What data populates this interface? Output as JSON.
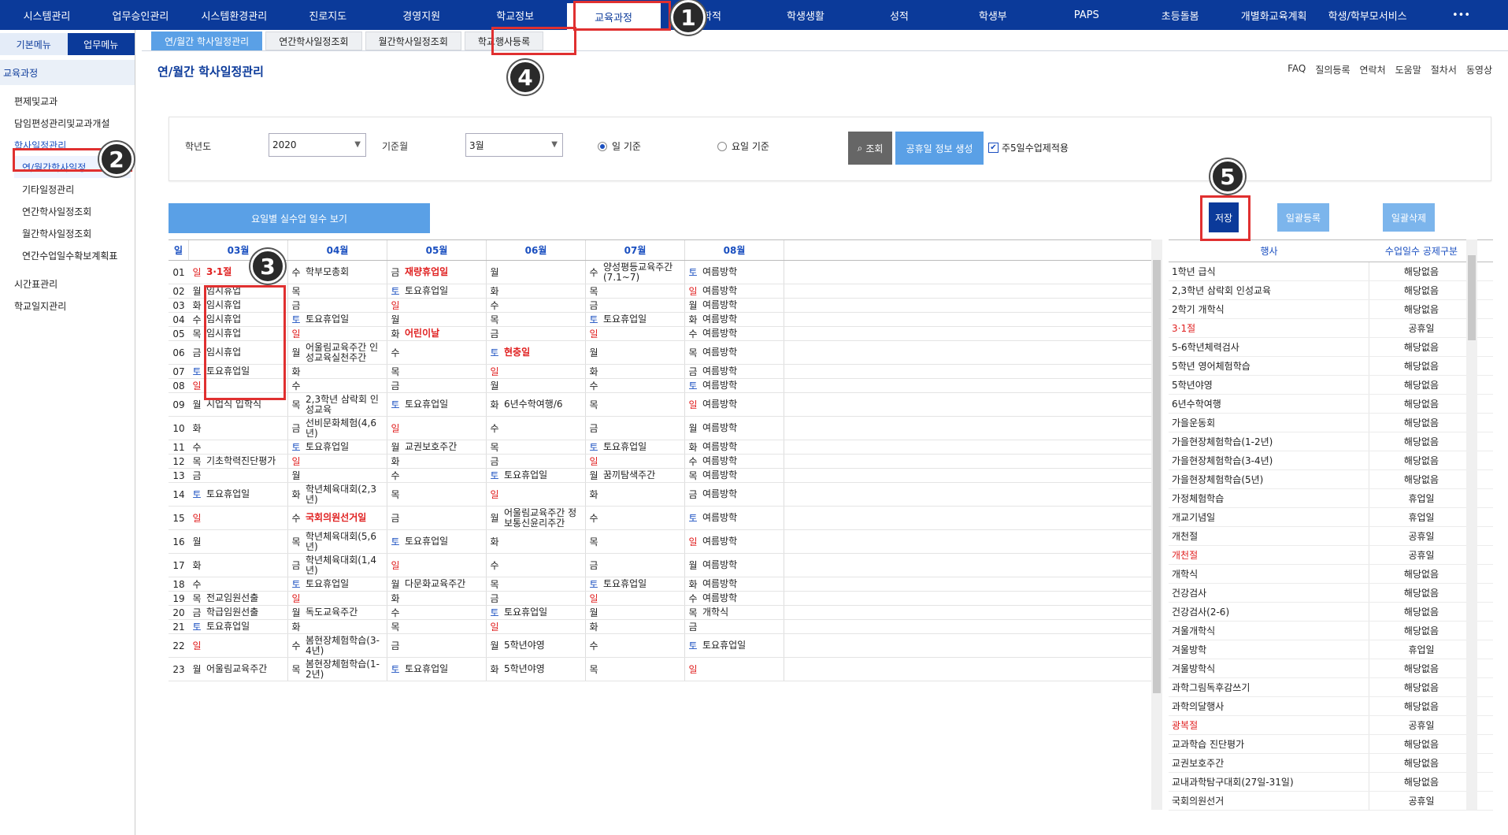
{
  "topnav": [
    "시스템관리",
    "업무승인관리",
    "시스템환경관리",
    "진로지도",
    "경영지원",
    "학교정보",
    "교육과정",
    "학적",
    "학생생활",
    "성적",
    "학생부",
    "PAPS",
    "초등돌봄",
    "개별화교육계획",
    "학생/학부모서비스",
    "•••"
  ],
  "sidebar": {
    "tabs": [
      "기본메뉴",
      "업무메뉴"
    ],
    "section": "교육과정",
    "items": [
      {
        "label": "편제및교과",
        "sub": false
      },
      {
        "label": "담임편성관리및교과개설",
        "sub": false
      },
      {
        "label": "학사일정관리",
        "sub": false,
        "hl": true
      },
      {
        "label": "연/월간학사일정",
        "sub": true,
        "active": true
      },
      {
        "label": "기타일정관리",
        "sub": true
      },
      {
        "label": "연간학사일정조회",
        "sub": true
      },
      {
        "label": "월간학사일정조회",
        "sub": true
      },
      {
        "label": "연간수업일수확보계획표",
        "sub": true
      },
      {
        "label": "",
        "gap": true
      },
      {
        "label": "시간표관리",
        "sub": false
      },
      {
        "label": "학교일지관리",
        "sub": false
      }
    ]
  },
  "subtabs": [
    "연/월간 학사일정관리",
    "연간학사일정조회",
    "월간학사일정조회",
    "학교행사등록"
  ],
  "page": {
    "title": "연/월간 학사일정관리",
    "links": [
      "FAQ",
      "질의등록",
      "연락처",
      "도움말",
      "절차서",
      "동영상"
    ]
  },
  "filter": {
    "year_label": "학년도",
    "year": "2020",
    "month_label": "기준월",
    "month": "3월",
    "radio1": "일 기준",
    "radio2": "요일 기준",
    "search": "조회",
    "generate": "공휴일 정보 생성",
    "chk_label": "주5일수업제적용",
    "chk_mark": "✔"
  },
  "view_btn": "요일별 실수업 일수 보기",
  "buttons": {
    "save": "저장",
    "bulk_reg": "일괄등록",
    "bulk_del": "일괄삭제"
  },
  "calendar": {
    "day_header": "일",
    "months": [
      "03월",
      "04월",
      "05월",
      "06월",
      "07월",
      "08월"
    ],
    "rows": [
      {
        "d": "01",
        "c": [
          [
            "일",
            "3·1절"
          ],
          [
            "수",
            "학부모총회"
          ],
          [
            "금",
            "재량휴업일"
          ],
          [
            "월",
            ""
          ],
          [
            "수",
            "양성평등교육주간(7.1~7)"
          ],
          [
            "토",
            "여름방학"
          ]
        ]
      },
      {
        "d": "02",
        "c": [
          [
            "월",
            "임시휴업"
          ],
          [
            "목",
            ""
          ],
          [
            "토",
            "토요휴업일"
          ],
          [
            "화",
            ""
          ],
          [
            "목",
            ""
          ],
          [
            "일",
            "여름방학"
          ]
        ]
      },
      {
        "d": "03",
        "c": [
          [
            "화",
            "임시휴업"
          ],
          [
            "금",
            ""
          ],
          [
            "일",
            ""
          ],
          [
            "수",
            ""
          ],
          [
            "금",
            ""
          ],
          [
            "월",
            "여름방학"
          ]
        ]
      },
      {
        "d": "04",
        "c": [
          [
            "수",
            "임시휴업"
          ],
          [
            "토",
            "토요휴업일"
          ],
          [
            "월",
            ""
          ],
          [
            "목",
            ""
          ],
          [
            "토",
            "토요휴업일"
          ],
          [
            "화",
            "여름방학"
          ]
        ]
      },
      {
        "d": "05",
        "c": [
          [
            "목",
            "임시휴업"
          ],
          [
            "일",
            ""
          ],
          [
            "화",
            "어린이날"
          ],
          [
            "금",
            ""
          ],
          [
            "일",
            ""
          ],
          [
            "수",
            "여름방학"
          ]
        ]
      },
      {
        "d": "06",
        "c": [
          [
            "금",
            "임시휴업"
          ],
          [
            "월",
            "어울림교육주간 인성교육실천주간"
          ],
          [
            "수",
            ""
          ],
          [
            "토",
            "현충일"
          ],
          [
            "월",
            ""
          ],
          [
            "목",
            "여름방학"
          ]
        ]
      },
      {
        "d": "07",
        "c": [
          [
            "토",
            "토요휴업일"
          ],
          [
            "화",
            ""
          ],
          [
            "목",
            ""
          ],
          [
            "일",
            ""
          ],
          [
            "화",
            ""
          ],
          [
            "금",
            "여름방학"
          ]
        ]
      },
      {
        "d": "08",
        "c": [
          [
            "일",
            ""
          ],
          [
            "수",
            ""
          ],
          [
            "금",
            ""
          ],
          [
            "월",
            ""
          ],
          [
            "수",
            ""
          ],
          [
            "토",
            "여름방학"
          ]
        ]
      },
      {
        "d": "09",
        "c": [
          [
            "월",
            "시업식 입학식"
          ],
          [
            "목",
            "2,3학년 삼락회 인성교육"
          ],
          [
            "토",
            "토요휴업일"
          ],
          [
            "화",
            "6년수학여행/6"
          ],
          [
            "목",
            ""
          ],
          [
            "일",
            "여름방학"
          ]
        ]
      },
      {
        "d": "10",
        "c": [
          [
            "화",
            ""
          ],
          [
            "금",
            "선비문화체험(4,6년)"
          ],
          [
            "일",
            ""
          ],
          [
            "수",
            ""
          ],
          [
            "금",
            ""
          ],
          [
            "월",
            "여름방학"
          ]
        ]
      },
      {
        "d": "11",
        "c": [
          [
            "수",
            ""
          ],
          [
            "토",
            "토요휴업일"
          ],
          [
            "월",
            "교권보호주간"
          ],
          [
            "목",
            ""
          ],
          [
            "토",
            "토요휴업일"
          ],
          [
            "화",
            "여름방학"
          ]
        ]
      },
      {
        "d": "12",
        "c": [
          [
            "목",
            "기초학력진단평가"
          ],
          [
            "일",
            ""
          ],
          [
            "화",
            ""
          ],
          [
            "금",
            ""
          ],
          [
            "일",
            ""
          ],
          [
            "수",
            "여름방학"
          ]
        ]
      },
      {
        "d": "13",
        "c": [
          [
            "금",
            ""
          ],
          [
            "월",
            ""
          ],
          [
            "수",
            ""
          ],
          [
            "토",
            "토요휴업일"
          ],
          [
            "월",
            "꿈끼탐색주간"
          ],
          [
            "목",
            "여름방학"
          ]
        ]
      },
      {
        "d": "14",
        "c": [
          [
            "토",
            "토요휴업일"
          ],
          [
            "화",
            "학년체육대회(2,3년)"
          ],
          [
            "목",
            ""
          ],
          [
            "일",
            ""
          ],
          [
            "화",
            ""
          ],
          [
            "금",
            "여름방학"
          ]
        ]
      },
      {
        "d": "15",
        "c": [
          [
            "일",
            ""
          ],
          [
            "수",
            "국회의원선거일"
          ],
          [
            "금",
            ""
          ],
          [
            "월",
            "어울림교육주간 정보통신윤리주간"
          ],
          [
            "수",
            ""
          ],
          [
            "토",
            "여름방학"
          ]
        ]
      },
      {
        "d": "16",
        "c": [
          [
            "월",
            ""
          ],
          [
            "목",
            "학년체육대회(5,6년)"
          ],
          [
            "토",
            "토요휴업일"
          ],
          [
            "화",
            ""
          ],
          [
            "목",
            ""
          ],
          [
            "일",
            "여름방학"
          ]
        ]
      },
      {
        "d": "17",
        "c": [
          [
            "화",
            ""
          ],
          [
            "금",
            "학년체육대회(1,4년)"
          ],
          [
            "일",
            ""
          ],
          [
            "수",
            ""
          ],
          [
            "금",
            ""
          ],
          [
            "월",
            "여름방학"
          ]
        ]
      },
      {
        "d": "18",
        "c": [
          [
            "수",
            ""
          ],
          [
            "토",
            "토요휴업일"
          ],
          [
            "월",
            "다문화교육주간"
          ],
          [
            "목",
            ""
          ],
          [
            "토",
            "토요휴업일"
          ],
          [
            "화",
            "여름방학"
          ]
        ]
      },
      {
        "d": "19",
        "c": [
          [
            "목",
            "전교임원선출"
          ],
          [
            "일",
            ""
          ],
          [
            "화",
            ""
          ],
          [
            "금",
            ""
          ],
          [
            "일",
            ""
          ],
          [
            "수",
            "여름방학"
          ]
        ]
      },
      {
        "d": "20",
        "c": [
          [
            "금",
            "학급임원선출"
          ],
          [
            "월",
            "독도교육주간"
          ],
          [
            "수",
            ""
          ],
          [
            "토",
            "토요휴업일"
          ],
          [
            "월",
            ""
          ],
          [
            "목",
            "개학식"
          ]
        ]
      },
      {
        "d": "21",
        "c": [
          [
            "토",
            "토요휴업일"
          ],
          [
            "화",
            ""
          ],
          [
            "목",
            ""
          ],
          [
            "일",
            ""
          ],
          [
            "화",
            ""
          ],
          [
            "금",
            ""
          ]
        ]
      },
      {
        "d": "22",
        "c": [
          [
            "일",
            ""
          ],
          [
            "수",
            "봄현장체험학습(3-4년)"
          ],
          [
            "금",
            ""
          ],
          [
            "월",
            "5학년야영"
          ],
          [
            "수",
            ""
          ],
          [
            "토",
            "토요휴업일"
          ]
        ]
      },
      {
        "d": "23",
        "c": [
          [
            "월",
            "어울림교육주간"
          ],
          [
            "목",
            "봄현장체험학습(1-2년)"
          ],
          [
            "토",
            "토요휴업일"
          ],
          [
            "화",
            "5학년야영"
          ],
          [
            "목",
            ""
          ],
          [
            "일",
            ""
          ]
        ]
      }
    ]
  },
  "events": {
    "headers": [
      "행사",
      "수업일수 공제구분"
    ],
    "rows": [
      [
        "1학년 급식",
        "해당없음"
      ],
      [
        "2,3학년 삼락회 인성교육",
        "해당없음"
      ],
      [
        "2학기 개학식",
        "해당없음"
      ],
      [
        "3·1절",
        "공휴일"
      ],
      [
        "5-6학년체력검사",
        "해당없음"
      ],
      [
        "5학년 영어체험학습",
        "해당없음"
      ],
      [
        "5학년야영",
        "해당없음"
      ],
      [
        "6년수학여행",
        "해당없음"
      ],
      [
        "가을운동회",
        "해당없음"
      ],
      [
        "가을현장체험학습(1-2년)",
        "해당없음"
      ],
      [
        "가을현장체험학습(3-4년)",
        "해당없음"
      ],
      [
        "가을현장체험학습(5년)",
        "해당없음"
      ],
      [
        "가정체험학습",
        "휴업일"
      ],
      [
        "개교기념일",
        "휴업일"
      ],
      [
        "개천절",
        "공휴일"
      ],
      [
        "개천절",
        "공휴일"
      ],
      [
        "개학식",
        "해당없음"
      ],
      [
        "건강검사",
        "해당없음"
      ],
      [
        "건강검사(2-6)",
        "해당없음"
      ],
      [
        "겨울개학식",
        "해당없음"
      ],
      [
        "겨울방학",
        "휴업일"
      ],
      [
        "겨울방학식",
        "해당없음"
      ],
      [
        "과학그림독후감쓰기",
        "해당없음"
      ],
      [
        "과학의달행사",
        "해당없음"
      ],
      [
        "광복절",
        "공휴일"
      ],
      [
        "교과학습 진단평가",
        "해당없음"
      ],
      [
        "교권보호주간",
        "해당없음"
      ],
      [
        "교내과학탐구대회(27일-31일)",
        "해당없음"
      ],
      [
        "국회의원선거",
        "공휴일"
      ]
    ],
    "red_rows": [
      3,
      15,
      24
    ]
  },
  "annotations": [
    "1",
    "2",
    "3",
    "4",
    "5"
  ]
}
